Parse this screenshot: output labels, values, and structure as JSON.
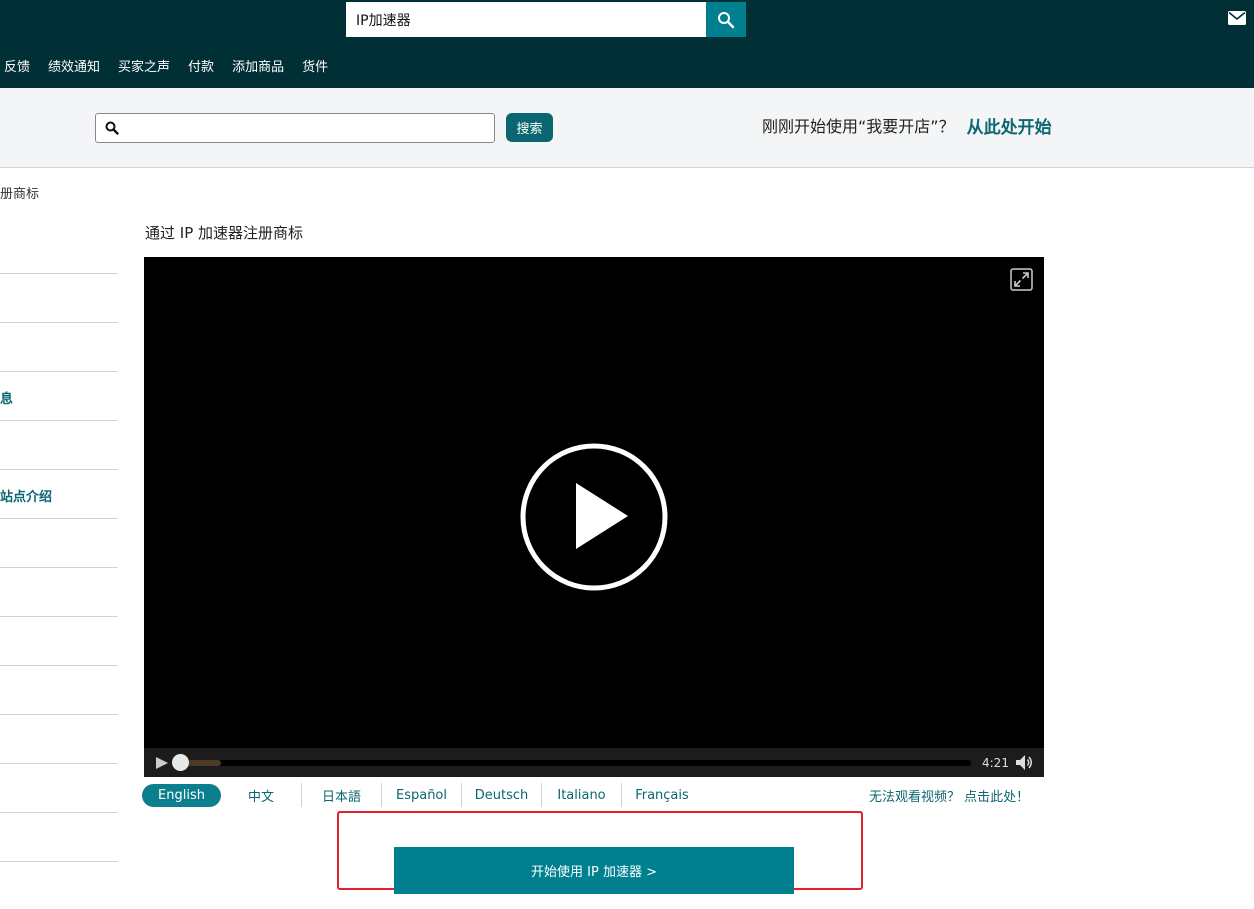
{
  "topbar": {
    "search_value": "IP加速器",
    "search_icon": "search-icon",
    "mail_icon": "mail-icon",
    "nav": [
      "反馈",
      "绩效通知",
      "买家之声",
      "付款",
      "添加商品",
      "货件"
    ]
  },
  "help_search": {
    "value": "",
    "button_label": "搜索",
    "promo_text": "刚刚开始使用“我要开店”？",
    "promo_link": "从此处开始"
  },
  "sidebar": {
    "partial_heading": "册商标",
    "items": [
      "",
      "",
      "",
      "息",
      "",
      "站点介绍",
      "",
      "",
      "",
      "",
      "",
      "",
      ""
    ]
  },
  "main": {
    "title": "通过 IP 加速器注册商标",
    "video": {
      "duration": "4:21",
      "progress": 0.0
    },
    "languages": [
      "English",
      "中文",
      "日本語",
      "Español",
      "Deutsch",
      "Italiano",
      "Français"
    ],
    "active_language": "English",
    "cant_watch": "无法观看视频？ 点击此处！",
    "start_button": "开始使用 IP 加速器 >"
  },
  "colors": {
    "topbar": "#002f36",
    "teal": "#0c6671",
    "accent": "#00808f",
    "highlight": "#e5202a"
  }
}
